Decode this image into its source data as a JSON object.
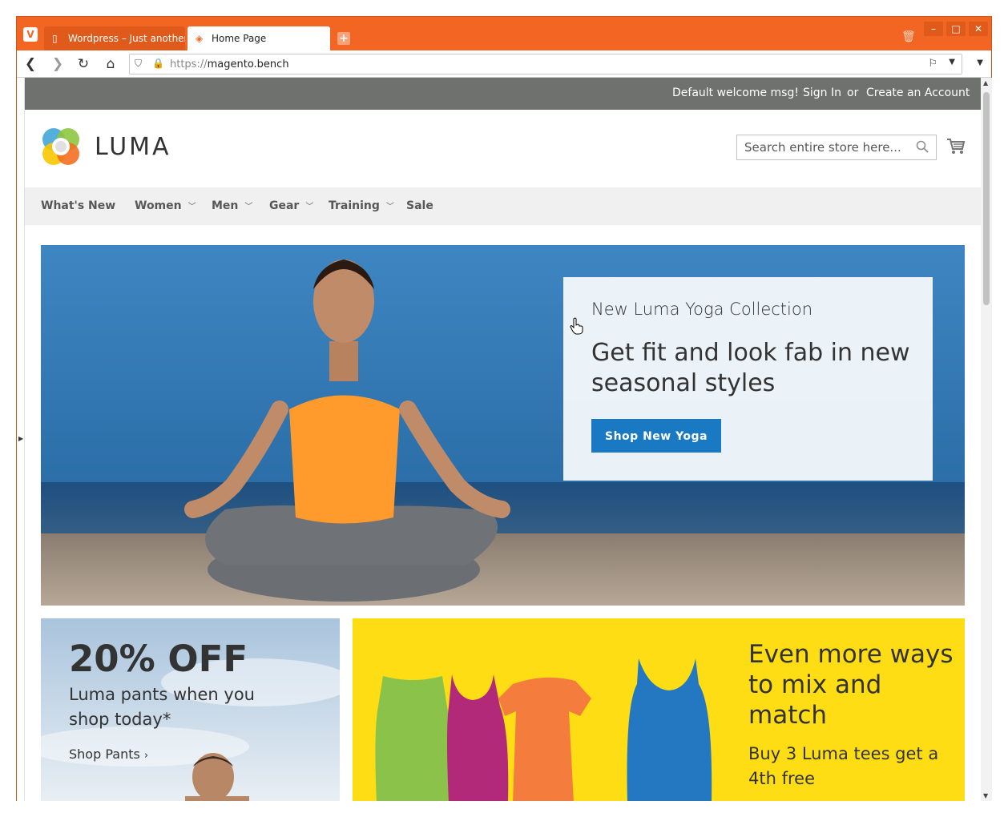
{
  "browser": {
    "tabs": [
      {
        "label": "Wordpress – Just another",
        "active": false
      },
      {
        "label": "Home Page",
        "active": true
      }
    ],
    "url_protocol": "https://",
    "url_host": "magento.bench"
  },
  "panel": {
    "welcome": "Default welcome msg!",
    "sign_in": "Sign In",
    "or": "or",
    "create_account": "Create an Account"
  },
  "header": {
    "logo_text": "LUMA",
    "search_placeholder": "Search entire store here..."
  },
  "nav": {
    "items": [
      {
        "label": "What's New",
        "has_dropdown": false
      },
      {
        "label": "Women",
        "has_dropdown": true
      },
      {
        "label": "Men",
        "has_dropdown": true
      },
      {
        "label": "Gear",
        "has_dropdown": true
      },
      {
        "label": "Training",
        "has_dropdown": true
      },
      {
        "label": "Sale",
        "has_dropdown": false
      }
    ]
  },
  "hero": {
    "subtitle": "New Luma Yoga Collection",
    "title": "Get fit and look fab in new seasonal styles",
    "button": "Shop New Yoga"
  },
  "promo_pants": {
    "headline": "20% OFF",
    "text": "Luma pants when you shop today*",
    "link": "Shop Pants"
  },
  "promo_tees": {
    "headline": "Even more ways to mix and match",
    "text": "Buy 3 Luma tees get a 4th free"
  },
  "colors": {
    "browser_chrome": "#f26522",
    "panel_bg": "#6e716e",
    "nav_bg": "#f0f0f0",
    "primary_button": "#1979c3",
    "promo_yellow": "#ffdd15"
  }
}
